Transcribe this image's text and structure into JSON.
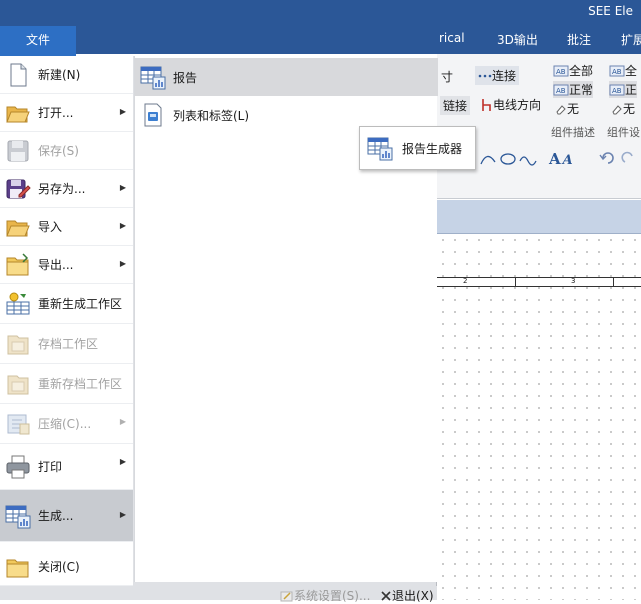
{
  "window": {
    "title": "SEE Ele"
  },
  "ribbon_tabs": [
    "rical",
    "3D输出",
    "批注",
    "扩展"
  ],
  "file_tab": {
    "label": "文件"
  },
  "ribbon": {
    "btn_dimension": "寸",
    "btn_connect": "连接",
    "btn_link": "链接",
    "btn_wire_dir": "电线方向",
    "opt_all": "全部",
    "opt_normal": "正常",
    "opt_none": "无",
    "opt_all2": "全",
    "opt_normal2": "正",
    "opt_none2": "无",
    "group_comp_desc": "组件描述",
    "group_comp_settings": "组件设"
  },
  "ruler": {
    "marks": [
      "2",
      "3"
    ]
  },
  "menu": {
    "items": [
      {
        "label": "新建(N)",
        "icon": "new-file-icon",
        "disabled": false,
        "arrow": false
      },
      {
        "label": "打开...",
        "icon": "open-folder-icon",
        "disabled": false,
        "arrow": true
      },
      {
        "label": "保存(S)",
        "icon": "save-icon",
        "disabled": true,
        "arrow": false
      },
      {
        "label": "另存为...",
        "icon": "save-as-icon",
        "disabled": false,
        "arrow": true
      },
      {
        "label": "导入",
        "icon": "import-folder-icon",
        "disabled": false,
        "arrow": true
      },
      {
        "label": "导出...",
        "icon": "export-folder-icon",
        "disabled": false,
        "arrow": true
      },
      {
        "label": "重新生成工作区",
        "icon": "regenerate-workspace-icon",
        "disabled": false,
        "arrow": false
      },
      {
        "label": "存档工作区",
        "icon": "archive-icon",
        "disabled": true,
        "arrow": false
      },
      {
        "label": "重新存档工作区",
        "icon": "rearchive-icon",
        "disabled": true,
        "arrow": false
      },
      {
        "label": "压缩(C)...",
        "icon": "compress-icon",
        "disabled": true,
        "arrow": true
      },
      {
        "label": "打印",
        "icon": "printer-icon",
        "disabled": false,
        "arrow": true
      },
      {
        "label": "生成...",
        "icon": "generate-report-icon",
        "disabled": false,
        "arrow": true
      },
      {
        "label": "关闭(C)",
        "icon": "close-folder-icon",
        "disabled": false,
        "arrow": false
      }
    ]
  },
  "submenu": {
    "items": [
      {
        "label": "报告",
        "icon": "report-icon"
      },
      {
        "label": "列表和标签(L)",
        "icon": "list-label-icon"
      }
    ]
  },
  "tooltip": {
    "label": "报告生成器",
    "icon": "report-generator-icon"
  },
  "bottom": {
    "settings": "系统设置(S)...",
    "exit": "退出(X)"
  }
}
